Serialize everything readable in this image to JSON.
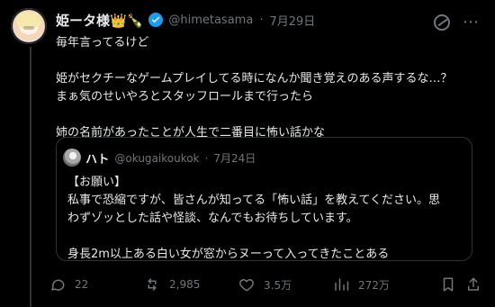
{
  "tweet": {
    "author": {
      "display_name": "姫ータ様👑🍾",
      "handle": "@himetasama",
      "date": "7月29日"
    },
    "text": "毎年言ってるけど\n\n姫がセクチーなゲームプレイしてる時になんか聞き覚えのある声するな…？\nまぁ気のせいやろとスタッフロールまで行ったら\n\n姉の名前があったことが人生で二番目に怖い話かな",
    "quote": {
      "display_name": "ハト",
      "handle": "@okugaikoukok",
      "date": "7月24日",
      "text": "【お願い】\n私事で恐縮ですが、皆さんが知ってる「怖い話」を教えてください。思\nわずゾッとした話や怪談、なんでもお待ちしています。\n\n身長2m以上ある白い女が窓からヌーって入ってきたことある"
    },
    "stats": {
      "replies": "22",
      "reposts": "2,985",
      "likes": "3.5万",
      "views": "272万"
    }
  },
  "icons": {
    "verified": "verified-badge-icon",
    "grok": "grok-icon",
    "more": "more-options-icon",
    "reply": "reply-icon",
    "repost": "repost-icon",
    "like": "like-icon",
    "views": "views-icon",
    "bookmark": "bookmark-icon",
    "share": "share-icon"
  },
  "colors": {
    "background": "#000000",
    "text_primary": "#e7e9ea",
    "text_secondary": "#71767b",
    "verified": "#1d9bf0",
    "border": "#2f3336"
  }
}
